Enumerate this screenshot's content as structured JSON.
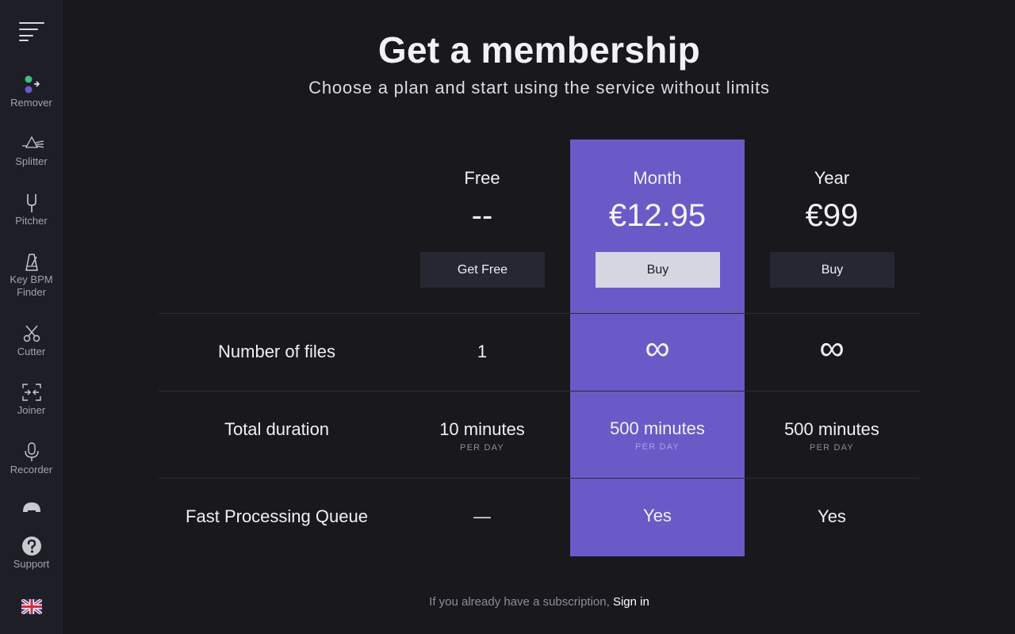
{
  "sidebar": {
    "items": [
      {
        "label": "Remover"
      },
      {
        "label": "Splitter"
      },
      {
        "label": "Pitcher"
      },
      {
        "label": "Key BPM Finder"
      },
      {
        "label": "Cutter"
      },
      {
        "label": "Joiner"
      },
      {
        "label": "Recorder"
      },
      {
        "label": "Support"
      }
    ],
    "icons": [
      "menu-icon",
      "remover-icon",
      "splitter-icon",
      "tuning-fork-icon",
      "metronome-icon",
      "scissors-icon",
      "joiner-icon",
      "microphone-icon",
      "headphones-icon",
      "question-icon",
      "uk-flag-icon"
    ]
  },
  "header": {
    "title": "Get a membership",
    "subtitle": "Choose a plan and start using the service without limits"
  },
  "plans": [
    {
      "name": "Free",
      "price": "--",
      "button": "Get Free"
    },
    {
      "name": "Month",
      "price": "€12.95",
      "button": "Buy"
    },
    {
      "name": "Year",
      "price": "€99",
      "button": "Buy"
    }
  ],
  "features": {
    "files": {
      "label": "Number of files",
      "free": "1",
      "month": "∞",
      "year": "∞"
    },
    "duration": {
      "label": "Total duration",
      "free": "10 minutes",
      "month": "500 minutes",
      "year": "500 minutes",
      "unit": "PER DAY"
    },
    "queue": {
      "label": "Fast Processing Queue",
      "free": "—",
      "month": "Yes",
      "year": "Yes"
    }
  },
  "footer": {
    "text": "If you already have a subscription,",
    "link": "Sign in"
  },
  "colors": {
    "background": "#18181d",
    "sidebar": "#1e1e26",
    "highlight": "#6a5ac7",
    "button_dark": "#272733",
    "button_light": "#d6d6e2"
  }
}
